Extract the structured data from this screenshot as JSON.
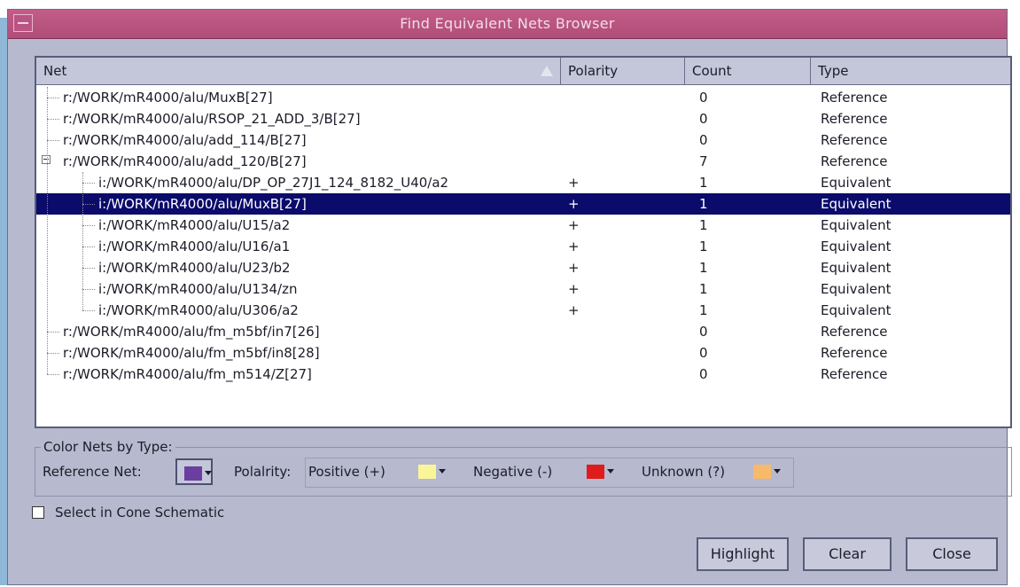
{
  "window": {
    "title": "Find Equivalent Nets Browser"
  },
  "table": {
    "columns": [
      "Net",
      "Polarity",
      "Count",
      "Type"
    ],
    "rows": [
      {
        "net": "r:/WORK/mR4000/alu/MuxB[27]",
        "polarity": "",
        "count": "0",
        "type": "Reference"
      },
      {
        "net": "r:/WORK/mR4000/alu/RSOP_21_ADD_3/B[27]",
        "polarity": "",
        "count": "0",
        "type": "Reference"
      },
      {
        "net": "r:/WORK/mR4000/alu/add_114/B[27]",
        "polarity": "",
        "count": "0",
        "type": "Reference"
      },
      {
        "net": "r:/WORK/mR4000/alu/add_120/B[27]",
        "polarity": "",
        "count": "7",
        "type": "Reference"
      },
      {
        "net": "i:/WORK/mR4000/alu/DP_OP_27J1_124_8182_U40/a2",
        "polarity": "+",
        "count": "1",
        "type": "Equivalent"
      },
      {
        "net": "i:/WORK/mR4000/alu/MuxB[27]",
        "polarity": "+",
        "count": "1",
        "type": "Equivalent"
      },
      {
        "net": "i:/WORK/mR4000/alu/U15/a2",
        "polarity": "+",
        "count": "1",
        "type": "Equivalent"
      },
      {
        "net": "i:/WORK/mR4000/alu/U16/a1",
        "polarity": "+",
        "count": "1",
        "type": "Equivalent"
      },
      {
        "net": "i:/WORK/mR4000/alu/U23/b2",
        "polarity": "+",
        "count": "1",
        "type": "Equivalent"
      },
      {
        "net": "i:/WORK/mR4000/alu/U134/zn",
        "polarity": "+",
        "count": "1",
        "type": "Equivalent"
      },
      {
        "net": "i:/WORK/mR4000/alu/U306/a2",
        "polarity": "+",
        "count": "1",
        "type": "Equivalent"
      },
      {
        "net": "r:/WORK/mR4000/alu/fm_m5bf/in7[26]",
        "polarity": "",
        "count": "0",
        "type": "Reference"
      },
      {
        "net": "r:/WORK/mR4000/alu/fm_m5bf/in8[28]",
        "polarity": "",
        "count": "0",
        "type": "Reference"
      },
      {
        "net": "r:/WORK/mR4000/alu/fm_m514/Z[27]",
        "polarity": "",
        "count": "0",
        "type": "Reference"
      }
    ]
  },
  "color_nets": {
    "title": "Color Nets by Type:",
    "reference_label": "Reference Net:",
    "reference_color": "#6a3fa0",
    "polarity_label": "Polalrity:",
    "positive_label": "Positive (+)",
    "positive_color": "#fbf59a",
    "negative_label": "Negative (-)",
    "negative_color": "#e01b1b",
    "unknown_label": "Unknown (?)",
    "unknown_color": "#f7b96a"
  },
  "select_cone": {
    "label": "Select in Cone Schematic",
    "checked": false
  },
  "buttons": {
    "highlight": "Highlight",
    "clear": "Clear",
    "close": "Close"
  }
}
